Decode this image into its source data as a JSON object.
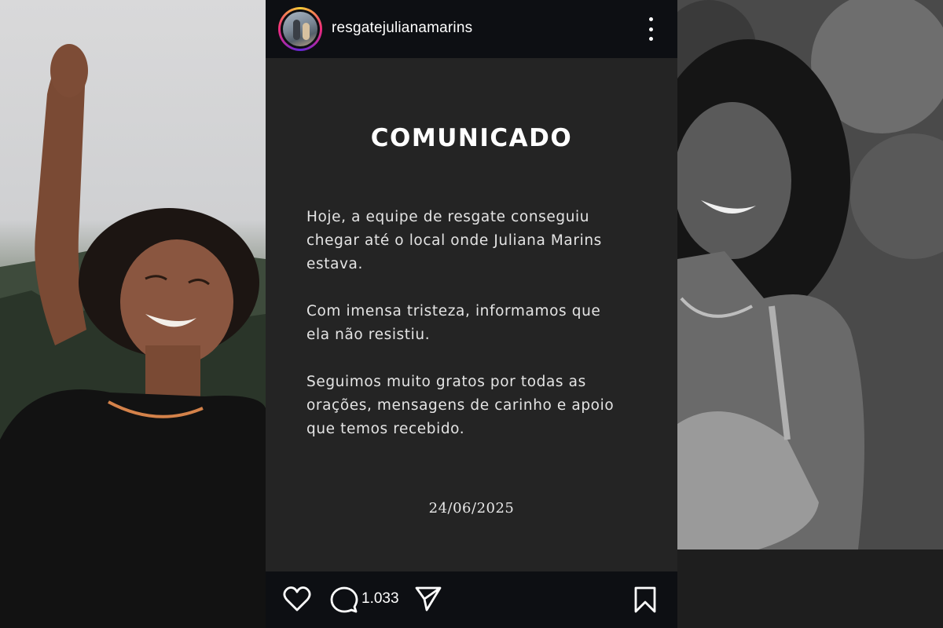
{
  "post": {
    "username": "resgatejulianamarins",
    "title": "COMUNICADO",
    "paragraphs": [
      "Hoje, a equipe de resgate conseguiu\nchegar até o local onde Juliana Marins\nestava.",
      "Com imensa tristeza, informamos que\nela não resistiu.",
      "Seguimos muito gratos por todas as\norações, mensagens de carinho e apoio\nque temos recebido."
    ],
    "date": "24/06/2025",
    "comments_count": "1.033"
  },
  "icons": {
    "more": "more-vertical-icon",
    "like": "heart-icon",
    "comment": "comment-icon",
    "share": "send-icon",
    "save": "bookmark-icon"
  },
  "colors": {
    "post_background": "#242424",
    "bar_background": "#0d0f13",
    "text": "#ffffff"
  }
}
